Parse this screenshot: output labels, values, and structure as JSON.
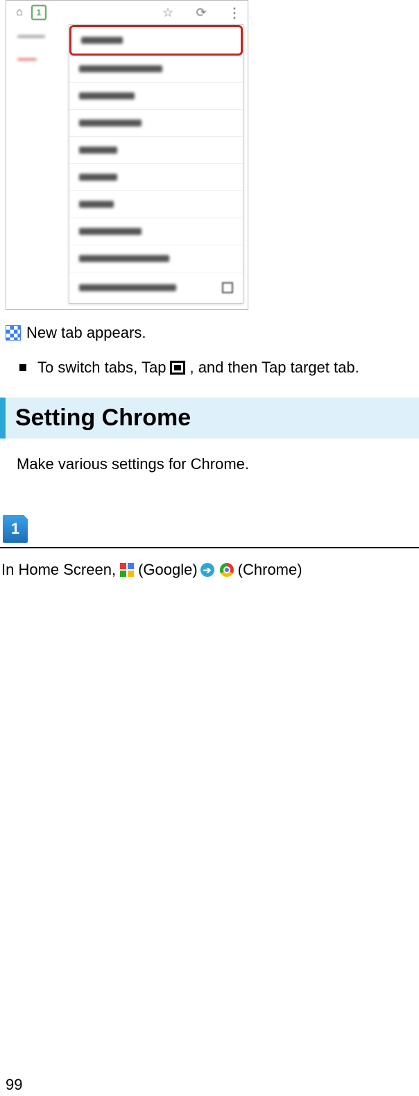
{
  "screenshot": {
    "toolbar": {
      "home_icon": "home-icon",
      "tab_count_icon": "tab-switcher-icon",
      "star_icon": "star-icon",
      "download_icon": "download-arrow-icon",
      "overflow_icon": "kebab-menu-icon"
    },
    "menu": {
      "new_tab": "New tab",
      "new_incognito": "New incognito tab",
      "bookmarks": "Bookmarks",
      "recent_tabs": "Recent tabs",
      "history": "History",
      "share": "Share...",
      "print": "Print...",
      "find_in_page": "Find in page",
      "add_to_home": "Add to homescreen",
      "request_desktop": "Request desktop site"
    }
  },
  "result_text": "New tab appears.",
  "switch_tabs": {
    "pre": "To switch tabs, Tap ",
    "post": ", and then Tap target tab."
  },
  "heading": "Setting Chrome",
  "intro": "Make various settings for Chrome.",
  "step": {
    "number": "1",
    "pre": "In Home Screen, ",
    "google": " (Google)",
    "chrome": " (Chrome)"
  },
  "page_number": "99"
}
